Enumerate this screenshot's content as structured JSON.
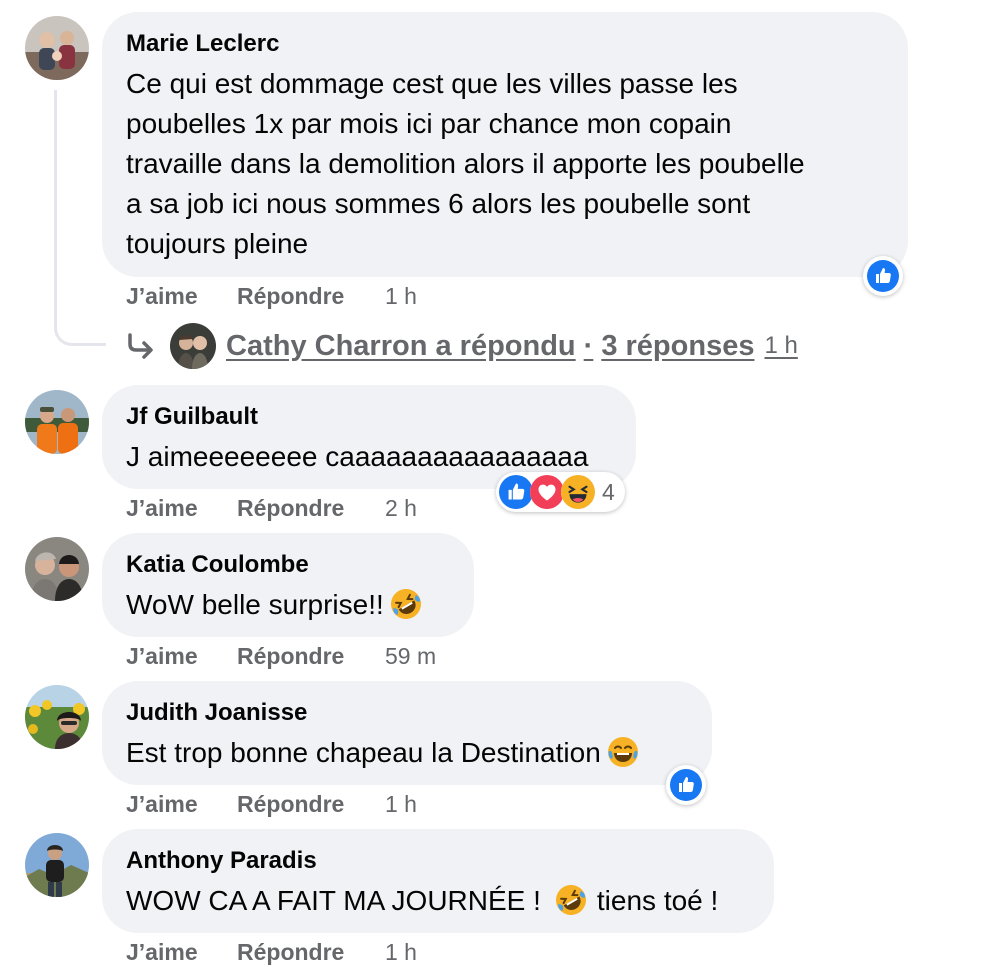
{
  "comments": [
    {
      "author": "Marie Leclerc",
      "lines": [
        "Ce qui est dommage cest que les villes passe les",
        "poubelles 1x par mois ici par chance mon copain",
        "travaille dans la demolition alors il apporte les poubelle",
        "a sa job ici nous sommes 6 alors les poubelle sont",
        "toujours pleine"
      ],
      "like_label": "J’aime",
      "reply_label": "Répondre",
      "time": "1 h",
      "reaction": "like"
    },
    {
      "author": "Jf Guilbault",
      "text": "J aimeeeeeeee caaaaaaaaaaaaaaaa",
      "like_label": "J’aime",
      "reply_label": "Répondre",
      "time": "2 h",
      "reactions": [
        "like",
        "love",
        "haha"
      ],
      "reaction_count": "4"
    },
    {
      "author": "Katia Coulombe",
      "text": "WoW belle surprise!!",
      "emoji": "rolling-on-floor-laughing",
      "like_label": "J’aime",
      "reply_label": "Répondre",
      "time": "59 m"
    },
    {
      "author": "Judith Joanisse",
      "text": "Est trop bonne chapeau la Destination",
      "emoji": "tears-of-joy",
      "like_label": "J’aime",
      "reply_label": "Répondre",
      "time": "1 h",
      "reaction": "like"
    },
    {
      "author": "Anthony Paradis",
      "text_before": "WOW CA A FAIT MA JOURNÉE !",
      "emoji": "rolling-on-floor-laughing",
      "text_after": "tiens toé !",
      "like_label": "J’aime",
      "reply_label": "Répondre",
      "time": "1 h"
    }
  ],
  "replies": {
    "text": "Cathy Charron a répondu",
    "separator": "·",
    "count": "3 réponses",
    "time": "1 h"
  },
  "colors": {
    "bubble": "#f0f2f5",
    "secondary_text": "#65676b",
    "like_blue": "#1877f2",
    "love_red": "#f33e58",
    "emoji_yellow": "#f7b125"
  }
}
